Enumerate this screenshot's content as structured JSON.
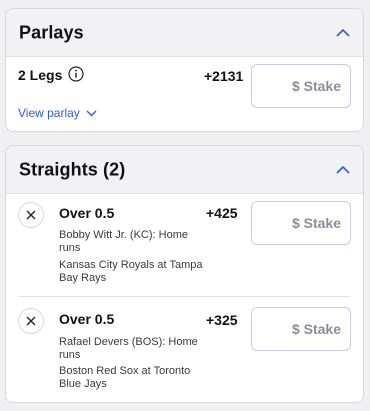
{
  "parlays": {
    "title": "Parlays",
    "legs_label": "2 Legs",
    "odds": "+2131",
    "stake_placeholder": "$ Stake",
    "view_link": "View parlay"
  },
  "straights": {
    "title": "Straights (2)",
    "bets": [
      {
        "title": "Over 0.5",
        "odds": "+425",
        "player_line1": "Bobby Witt Jr. (KC): Home",
        "player_line2": "runs",
        "game_line1": "Kansas City Royals at Tampa",
        "game_line2": "Bay Rays",
        "stake_placeholder": "$ Stake"
      },
      {
        "title": "Over 0.5",
        "odds": "+325",
        "player_line1": "Rafael Devers (BOS): Home",
        "player_line2": "runs",
        "game_line1": "Boston Red Sox at Toronto",
        "game_line2": "Blue Jays",
        "stake_placeholder": "$ Stake"
      }
    ]
  },
  "colors": {
    "link": "#2f5bd6",
    "header_bg": "#f2f2f4",
    "stake_border": "#c9c9e6"
  },
  "icons": [
    "chevron-up-icon",
    "info-icon",
    "chevron-down-icon",
    "close-icon"
  ]
}
